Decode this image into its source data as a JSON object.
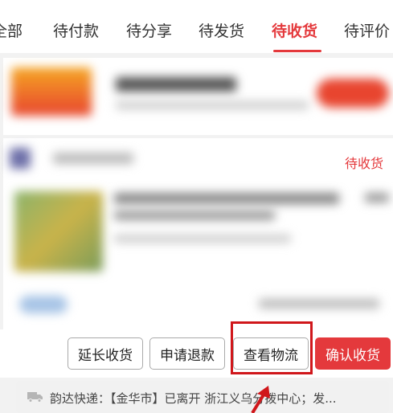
{
  "tabs": [
    {
      "label": "全部"
    },
    {
      "label": "待付款"
    },
    {
      "label": "待分享"
    },
    {
      "label": "待发货"
    },
    {
      "label": "待收货"
    },
    {
      "label": "待评价"
    }
  ],
  "active_tab": "待收货",
  "order": {
    "status": "待收货"
  },
  "actions": {
    "extend": "延长收货",
    "refund": "申请退款",
    "logistics": "查看物流",
    "confirm": "确认收货"
  },
  "logistics_info": {
    "icon": "truck-icon",
    "text": "韵达快递：【金华市】已离开 浙江义乌分拨中心；发..."
  },
  "colors": {
    "accent": "#e4393c",
    "highlight": "#d0171b"
  }
}
